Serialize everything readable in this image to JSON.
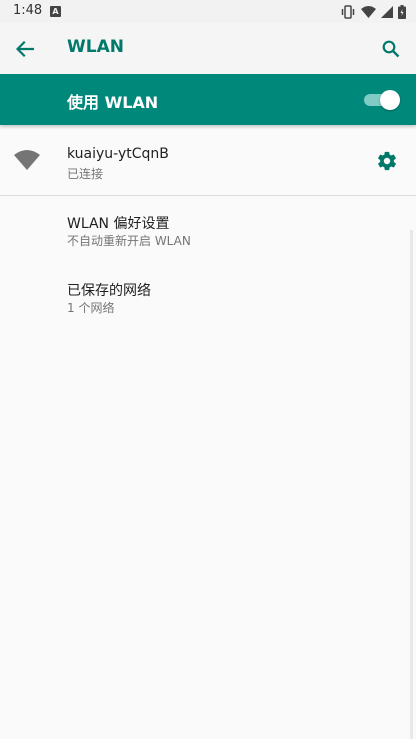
{
  "status_bar": {
    "time": "1:48",
    "notification_icon": "A"
  },
  "app_bar": {
    "title": "WLAN"
  },
  "master_switch": {
    "label": "使用 WLAN",
    "enabled": true
  },
  "connected_network": {
    "name": "kuaiyu-ytCqnB",
    "status": "已连接"
  },
  "menu": [
    {
      "title": "WLAN 偏好设置",
      "subtitle": "不自动重新开启 WLAN"
    },
    {
      "title": "已保存的网络",
      "subtitle": "1 个网络"
    }
  ],
  "colors": {
    "accent": "#00897b",
    "accent_dark": "#00796b",
    "toggle_track": "#80cbc4",
    "background": "#fafafa"
  },
  "icons": {
    "back": "arrow-back-icon",
    "search": "search-icon",
    "wifi": "wifi-signal-icon",
    "settings": "gear-icon",
    "vibrate": "vibrate-icon",
    "signal": "cellular-signal-icon",
    "battery": "battery-icon"
  }
}
